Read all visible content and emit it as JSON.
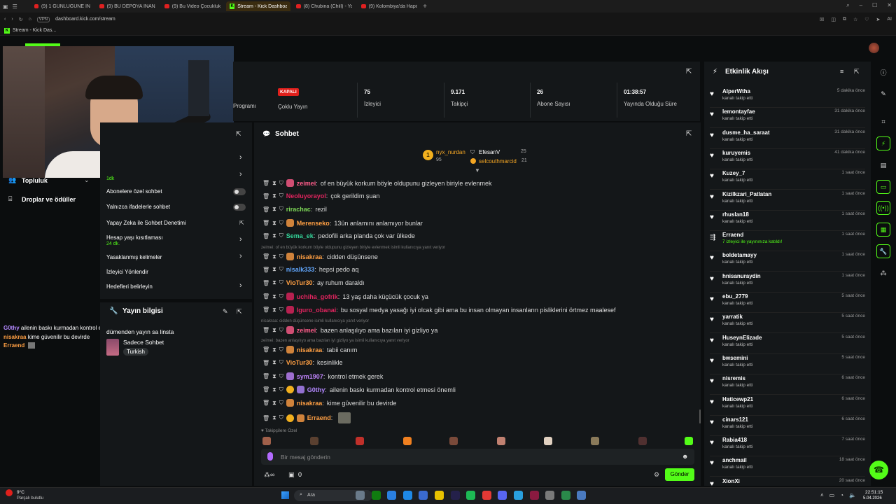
{
  "browser": {
    "tabs": [
      {
        "label": "(9) 1 GÜNLÜĞÜNE İNTERNE",
        "icon": "youtube-icon",
        "active": false
      },
      {
        "label": "(9) BU DEPOYA İNANAMA",
        "icon": "youtube-icon",
        "active": false
      },
      {
        "label": "(9) Bu Video Çocukluk Tra",
        "icon": "youtube-icon",
        "active": false
      },
      {
        "label": "Stream - Kick Dashboard",
        "icon": "kick-icon",
        "active": true
      },
      {
        "label": "(8) Chubina (Chill) - YouTu",
        "icon": "youtube-icon",
        "active": false
      },
      {
        "label": "(9) Kolombiya'da Hapishan",
        "icon": "youtube-icon",
        "active": false
      }
    ],
    "vpn": "VPN",
    "url": "dashboard.kick.com/stream",
    "ai_label": "AI",
    "bookmark": "Stream - Kick Das..."
  },
  "stats": {
    "col0_label": "Programı",
    "status_badge": "KAPALI",
    "multistream_label": "Çoklu Yayın",
    "viewers_value": "75",
    "viewers_label": "İzleyici",
    "followers_value": "9.171",
    "followers_label": "Takipçi",
    "subs_value": "26",
    "subs_label": "Abone Sayısı",
    "uptime_value": "01:38:57",
    "uptime_label": "Yayında Olduğu Süre"
  },
  "left_sidebar": {
    "community": "Topluluk",
    "drops": "Droplar ve ödüller",
    "partial": "1dk"
  },
  "chat_settings": {
    "rows": [
      {
        "label": "Abonelere özel sohbet",
        "control": "toggle"
      },
      {
        "label": "Yalnızca ifadelerle sohbet",
        "control": "toggle"
      },
      {
        "label": "Yapay Zeka ile Sohbet Denetimi",
        "control": "link"
      },
      {
        "label": "Hesap yaşı kısıtlaması",
        "sub": "24 dk.",
        "control": "chevron"
      },
      {
        "label": "Yasaklanmış kelimeler",
        "control": "chevron"
      },
      {
        "label": "İzleyici Yönlendir",
        "control": "none"
      },
      {
        "label": "Hedefleri belirleyin",
        "control": "chevron"
      }
    ]
  },
  "stream_info": {
    "title": "Yayın bilgisi",
    "stream_title": "dümenden yayın sa linsta",
    "category": "Sadece Sohbet",
    "tag": "Turkish"
  },
  "overlay_chat": [
    {
      "user": "G0thy",
      "color": "#b388ff",
      "text": "ailenin baskı kurmadan kontrol etmesi önemli"
    },
    {
      "user": "nisakraa",
      "color": "#ff9f43",
      "text": "kime güvenilir bu devirde"
    },
    {
      "user": "Erraend",
      "color": "#ff9f43",
      "text": ""
    }
  ],
  "chat": {
    "title": "Sohbet",
    "top_gifters": [
      {
        "name": "nyx_nurdan",
        "value": "95"
      },
      {
        "name": "EfesanV",
        "value": "25"
      },
      {
        "name": "selcouthmarcid",
        "value": "21"
      }
    ],
    "messages": [
      {
        "user": "zeimei",
        "color": "#ff5c8a",
        "text": "of en büyük korkum böyle oldupunu gizleyen biriyle evlenmek"
      },
      {
        "user": "Neoluyorayol",
        "color": "#e0245e",
        "text": "çok gerildim şuan"
      },
      {
        "user": "rirachac",
        "color": "#7ed957",
        "text": "rezil"
      },
      {
        "user": "Merenseko",
        "color": "#ff9f43",
        "text": "13ün anlamını anlamıyor bunlar"
      },
      {
        "user": "Sema_ek",
        "color": "#34d399",
        "text": "pedofili arka planda çok var ülkede"
      },
      {
        "user": "nisakraa",
        "color": "#ff9f43",
        "text": "cidden düşünsene"
      },
      {
        "user": "nisalk333",
        "color": "#60a5fa",
        "text": "hepsi pedo aq"
      },
      {
        "user": "VioTur30",
        "color": "#ff9f43",
        "text": "ay ruhum daraldı"
      },
      {
        "user": "uchiha_gofrik",
        "color": "#e0245e",
        "text": "13 yaş daha küçücük çocuk ya"
      },
      {
        "user": "Iguro_obanai",
        "color": "#e0245e",
        "text": "bu sosyal medya yasağı iyi olcak gibi ama bu insan olmayan insanların pisliklerini örtmez maalesef"
      },
      {
        "user": "zeimei",
        "color": "#ff5c8a",
        "text": "bazen anlaşılıyo ama bazıları iyi gizliyo ya"
      },
      {
        "user": "nisakraa",
        "color": "#ff9f43",
        "text": "tabii canım"
      },
      {
        "user": "VioTur30",
        "color": "#ff9f43",
        "text": "kesinlikle"
      },
      {
        "user": "sym1907",
        "color": "#c084fc",
        "text": "kontrol etmek gerek"
      },
      {
        "user": "G0thy",
        "color": "#b388ff",
        "text": "ailenin baskı kurmadan kontrol etmesi önemli"
      },
      {
        "user": "nisakraa",
        "color": "#ff9f43",
        "text": "kime güvenilir bu devirde"
      },
      {
        "user": "Erraend",
        "color": "#ff9f43",
        "text": ""
      }
    ],
    "replies": [
      "zeimei: of en büyük korkum böyle oldupunu gizleyen biriyle evlenmek isimli kullanıcıya yanıt veriyor",
      "nisakraa: cidden düşünsene isimli kullanıcıya yanıt veriyor",
      "zeimei: bazen anlaşılıyo ama bazıları iyi gizliyo ya isimli kullanıcıya yanıt veriyor"
    ],
    "follower_emotes_label": "Takipçilere Özel",
    "input_placeholder": "Bir mesaj gönderin",
    "points": "0",
    "send_label": "Gönder"
  },
  "activity": {
    "title": "Etkinlik Akışı",
    "items": [
      {
        "user": "AlperWtha",
        "sub": "kanalı takip etti",
        "time": "5 dakika önce"
      },
      {
        "user": "lemontayfae",
        "sub": "kanalı takip etti",
        "time": "31 dakika önce"
      },
      {
        "user": "dusme_ha_saraat",
        "sub": "kanalı takip etti",
        "time": "31 dakika önce"
      },
      {
        "user": "kuruyemis",
        "sub": "kanalı takip etti",
        "time": "41 dakika önce"
      },
      {
        "user": "Kuzey_7",
        "sub": "kanalı takip etti",
        "time": "1 saat önce"
      },
      {
        "user": "Kizilkzari_Patlatan",
        "sub": "kanalı takip etti",
        "time": "1 saat önce"
      },
      {
        "user": "rhuslan18",
        "sub": "kanalı takip etti",
        "time": "1 saat önce"
      },
      {
        "user": "Erraend",
        "sub": "7 izleyici ile yayınınıza katıldı!",
        "time": "1 saat önce",
        "raid": true
      },
      {
        "user": "boldetamayy",
        "sub": "kanalı takip etti",
        "time": "1 saat önce"
      },
      {
        "user": "hnisanuraydin",
        "sub": "kanalı takip etti",
        "time": "1 saat önce"
      },
      {
        "user": "ebu_2779",
        "sub": "kanalı takip etti",
        "time": "5 saat önce"
      },
      {
        "user": "yarratik",
        "sub": "kanalı takip etti",
        "time": "5 saat önce"
      },
      {
        "user": "HuseynElizade",
        "sub": "kanalı takip etti",
        "time": "5 saat önce"
      },
      {
        "user": "bwsemini",
        "sub": "kanalı takip etti",
        "time": "5 saat önce"
      },
      {
        "user": "nisremis",
        "sub": "kanalı takip etti",
        "time": "6 saat önce"
      },
      {
        "user": "Haticewp21",
        "sub": "kanalı takip etti",
        "time": "6 saat önce"
      },
      {
        "user": "cinars121",
        "sub": "kanalı takip etti",
        "time": "6 saat önce"
      },
      {
        "user": "Rabia418",
        "sub": "kanalı takip etti",
        "time": "7 saat önce"
      },
      {
        "user": "anchmail",
        "sub": "kanalı takip etti",
        "time": "18 saat önce"
      },
      {
        "user": "XionXi",
        "sub": "",
        "time": "20 saat önce"
      }
    ]
  },
  "taskbar": {
    "weather_temp": "9°C",
    "weather_desc": "Parçalı bulutlu",
    "search": "Ara",
    "time": "22:51:15",
    "date": "5.04.2026"
  },
  "colors": {
    "accent": "#53fc18",
    "panel": "#141719",
    "bg": "#0b0d0e",
    "offline": "#e0201c"
  }
}
